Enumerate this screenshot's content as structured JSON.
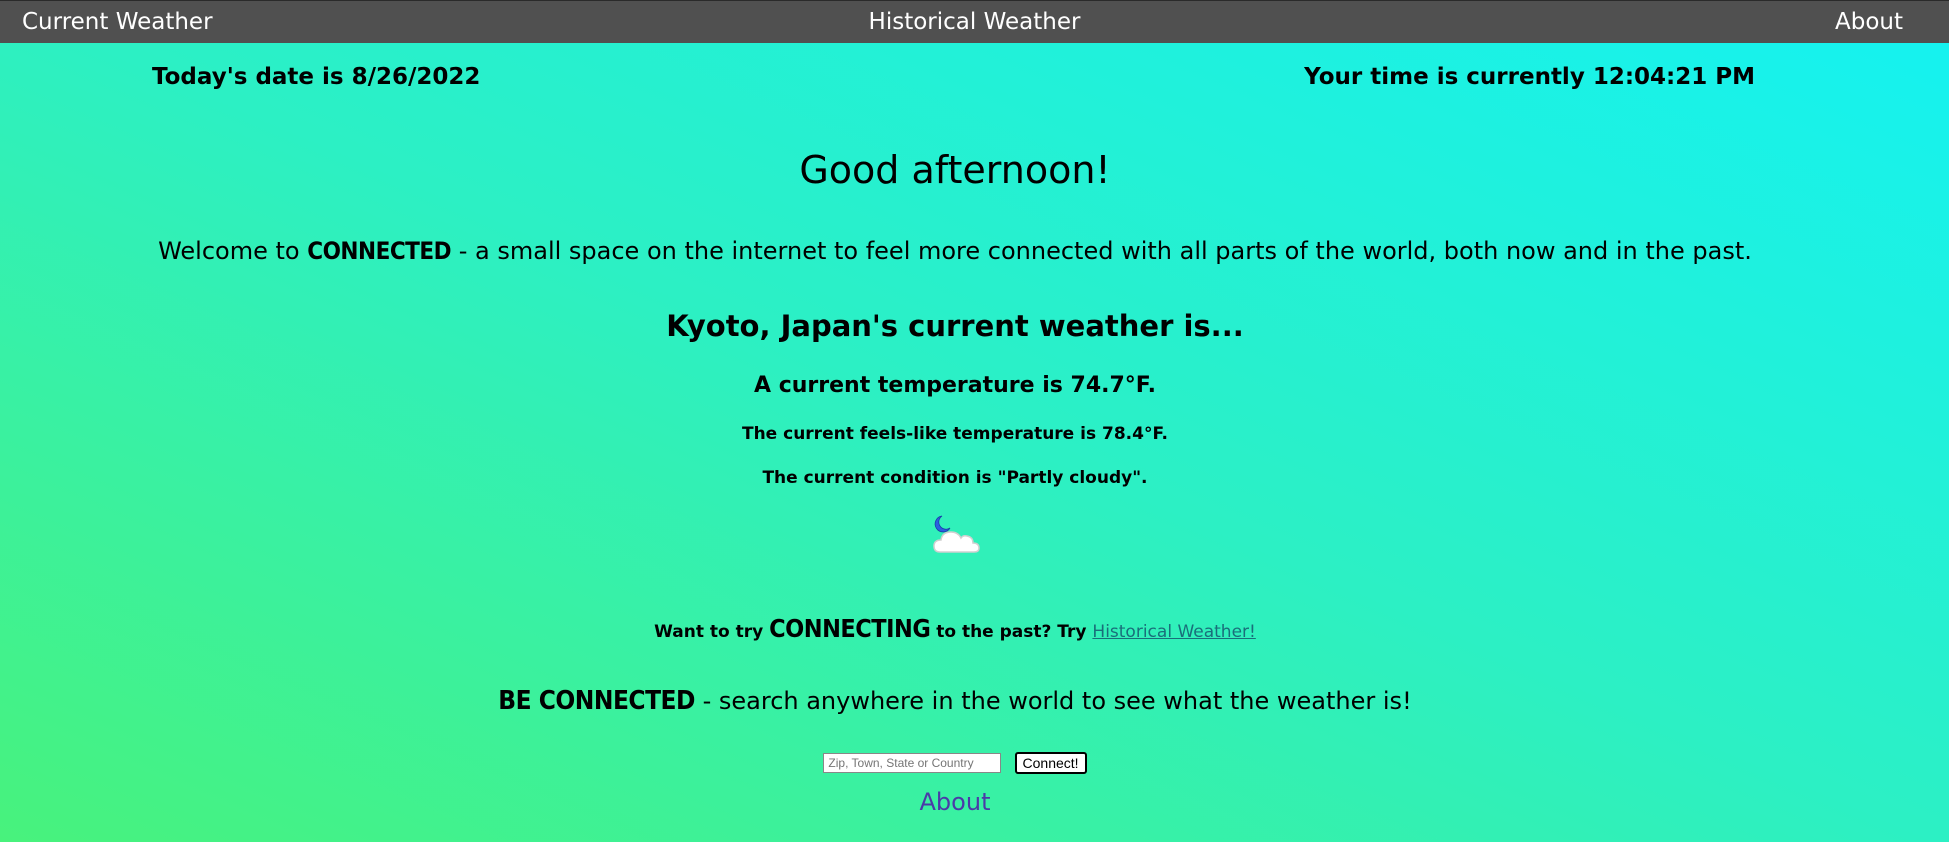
{
  "nav": {
    "current": "Current Weather",
    "historical": "Historical Weather",
    "about": "About"
  },
  "info": {
    "date": "Today's date is 8/26/2022",
    "time": "Your time is currently 12:04:21 PM"
  },
  "greeting": "Good afternoon!",
  "welcome": {
    "prefix": "Welcome to ",
    "brand": "CONNECTED",
    "suffix": " - a small space on the internet to feel more connected with all parts of the world, both now and in the past."
  },
  "weather": {
    "heading": "Kyoto, Japan's current weather is...",
    "temperature": "A current temperature is 74.7°F.",
    "feels_like": "The current feels-like temperature is 78.4°F.",
    "condition": "The current condition is \"Partly cloudy\".",
    "icon": "partly-cloudy-night-icon"
  },
  "try_past": {
    "prefix": "Want to try ",
    "brand": "CONNECTING",
    "middle": " to the past? Try ",
    "link": "Historical Weather!"
  },
  "be_connected": {
    "brand": "BE CONNECTED",
    "suffix": " - search anywhere in the world to see what the weather is!"
  },
  "search": {
    "placeholder": "Zip, Town, State or Country",
    "value": "",
    "button": "Connect!"
  },
  "footer_about": "About",
  "colors": {
    "nav_bg": "#505050",
    "gradient_start": "#48f27c",
    "gradient_end": "#14f2f2",
    "link": "#1a6e7a",
    "about_link": "#4b3aa8"
  }
}
